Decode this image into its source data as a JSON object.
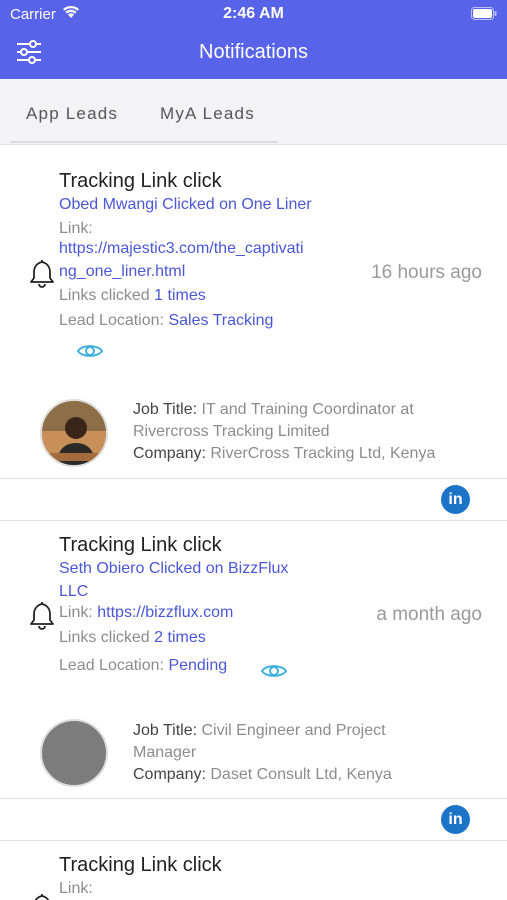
{
  "status": {
    "carrier": "Carrier",
    "time": "2:46 AM"
  },
  "header": {
    "title": "Notifications",
    "filter_icon": "sliders-icon"
  },
  "tabs": [
    {
      "label": "App Leads"
    },
    {
      "label": "MyA Leads"
    }
  ],
  "cards": [
    {
      "heading": "Tracking Link click",
      "clicked_line": "Obed Mwangi Clicked on One Liner",
      "link_label": "Link:",
      "link_url_1": "https://majestic3.com/the_captivati",
      "link_url_2": "ng_one_liner.html",
      "links_clicked_label": "Links clicked",
      "links_clicked_value": "1 times",
      "location_label": "Lead Location:",
      "location_value": "Sales Tracking",
      "time_ago": "16 hours ago",
      "job_title_label": "Job Title:",
      "job_title_1": "IT and Training Coordinator at",
      "job_title_2": "Rivercross Tracking Limited",
      "company_label": "Company:",
      "company_value": "RiverCross Tracking Ltd, Kenya",
      "linkedin": "in"
    },
    {
      "heading": "Tracking Link click",
      "clicked_line_1": "Seth Obiero Clicked on BizzFlux",
      "clicked_line_2": "LLC",
      "link_label": "Link:",
      "link_url": "https://bizzflux.com",
      "links_clicked_label": "Links clicked",
      "links_clicked_value": "2 times",
      "location_label": "Lead Location:",
      "location_value": "Pending",
      "time_ago": "a month ago",
      "job_title_label": "Job Title:",
      "job_title_1": "Civil Engineer and Project",
      "job_title_2": "Manager",
      "company_label": "Company:",
      "company_value": "Daset Consult Ltd, Kenya",
      "linkedin": "in"
    },
    {
      "heading": "Tracking Link click",
      "link_label": "Link:"
    }
  ],
  "colors": {
    "primary": "#5763e8",
    "link": "#4a57d6",
    "eye": "#3fb0e0",
    "linkedin": "#1c74c9"
  }
}
